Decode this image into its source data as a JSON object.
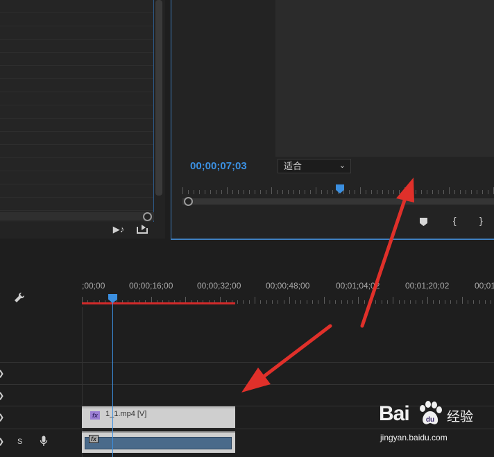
{
  "project_panel": {
    "icons": [
      "insert-audio-icon",
      "export-frame-icon"
    ]
  },
  "program_monitor": {
    "timecode": "00;00;07;03",
    "zoom": {
      "selected": "适合"
    },
    "playhead_fraction": 0.5
  },
  "timeline": {
    "ruler_labels": [
      ";00;00",
      "00;00;16;00",
      "00;00;32;00",
      "00;00;48;00",
      "00;01;04;02",
      "00;01;20;02",
      "00;01"
    ],
    "tracks": {
      "audio_solo_label": "S"
    },
    "clips": {
      "video_name": "1_1.mp4 [V]",
      "fx_label": "fx"
    }
  },
  "watermark": {
    "logo": "Bai",
    "logo2": "du",
    "text": "经验",
    "url": "jingyan.baidu.com"
  },
  "colors": {
    "accent_blue": "#3b8fe0",
    "work_area_red": "#d12a2a",
    "annotation_red": "#e0302a"
  }
}
